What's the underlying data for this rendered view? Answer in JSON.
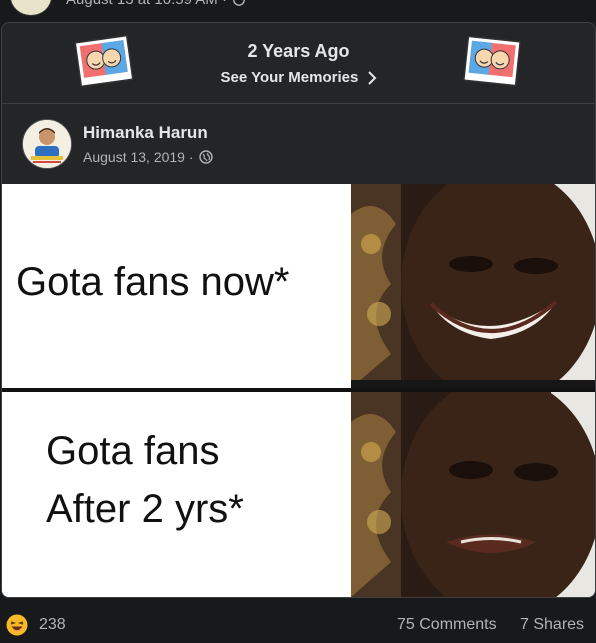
{
  "top": {
    "date_text": "August 13 at 10:59 AM ·"
  },
  "memories": {
    "title": "2 Years Ago",
    "link_label": "See Your Memories"
  },
  "post": {
    "author": "Himanka Harun",
    "date": "August 13, 2019 ·"
  },
  "meme": {
    "panel_top_text": "Gota fans now*",
    "panel_bottom_line1": "Gota fans",
    "panel_bottom_line2": "After 2 yrs*"
  },
  "footer": {
    "reaction_icon": "haha-emoji-icon",
    "reaction_count": "238",
    "comments": "75 Comments",
    "shares": "7 Shares"
  },
  "colors": {
    "background": "#18191a",
    "card": "#242526",
    "text": "#e4e6eb",
    "muted": "#b0b3b8",
    "emoji": "#f7b928"
  }
}
